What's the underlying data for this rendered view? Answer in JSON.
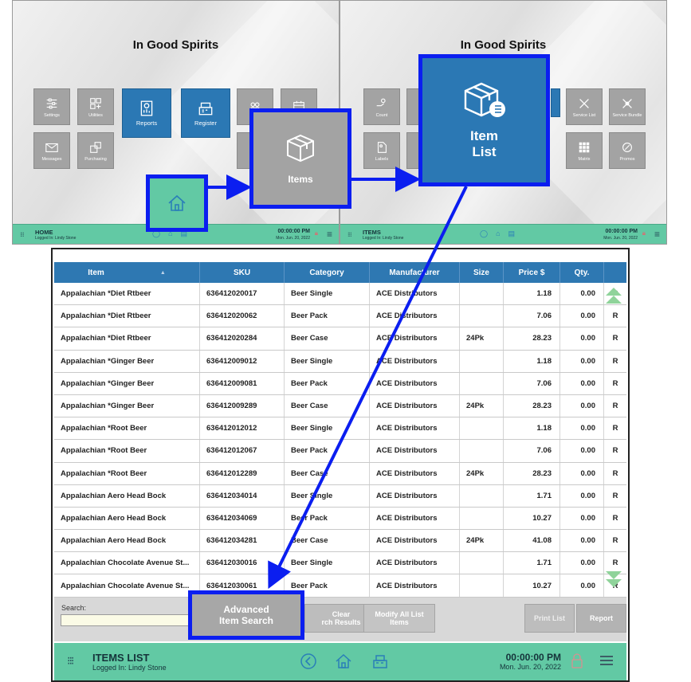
{
  "home_screen": {
    "title": "In Good Spirits",
    "tiles": {
      "settings": "Settings",
      "utilities": "Utilities",
      "reports": "Reports",
      "register": "Register",
      "messages": "Messages",
      "purchasing": "Purchasing"
    },
    "status_bar": {
      "name": "HOME",
      "user": "Logged In:  Lindy Stone",
      "time": "00:00:00 PM",
      "date": "Mon. Jun. 20, 2022"
    }
  },
  "items_screen": {
    "title": "In Good Spirits",
    "tiles": {
      "count": "Count",
      "labels": "Labels",
      "service_list": "Service List",
      "service_bundle": "Service Bundle",
      "matrix": "Matrix",
      "promos": "Promos"
    },
    "status_bar": {
      "name": "ITEMS",
      "user": "Logged In:  Lindy Stone",
      "time": "00:00:00 PM",
      "date": "Mon. Jun. 20, 2022"
    }
  },
  "callouts": {
    "items": "Items",
    "item_list_1": "Item",
    "item_list_2": "List",
    "advanced_search_1": "Advanced",
    "advanced_search_2": "Item Search"
  },
  "items_list": {
    "columns": [
      "Item",
      "SKU",
      "Category",
      "Manufacturer",
      "Size",
      "Price $",
      "Qty."
    ],
    "rows": [
      [
        "Appalachian *Diet Rtbeer",
        "636412020017",
        "Beer Single",
        "ACE Distributors",
        "",
        "1.18",
        "0.00",
        "R"
      ],
      [
        "Appalachian *Diet Rtbeer",
        "636412020062",
        "Beer Pack",
        "ACE Distributors",
        "",
        "7.06",
        "0.00",
        "R"
      ],
      [
        "Appalachian *Diet Rtbeer",
        "636412020284",
        "Beer Case",
        "ACE Distributors",
        "24Pk",
        "28.23",
        "0.00",
        "R"
      ],
      [
        "Appalachian *Ginger Beer",
        "636412009012",
        "Beer Single",
        "ACE Distributors",
        "",
        "1.18",
        "0.00",
        "R"
      ],
      [
        "Appalachian *Ginger Beer",
        "636412009081",
        "Beer Pack",
        "ACE Distributors",
        "",
        "7.06",
        "0.00",
        "R"
      ],
      [
        "Appalachian *Ginger Beer",
        "636412009289",
        "Beer Case",
        "ACE Distributors",
        "24Pk",
        "28.23",
        "0.00",
        "R"
      ],
      [
        "Appalachian *Root Beer",
        "636412012012",
        "Beer Single",
        "ACE Distributors",
        "",
        "1.18",
        "0.00",
        "R"
      ],
      [
        "Appalachian *Root Beer",
        "636412012067",
        "Beer Pack",
        "ACE Distributors",
        "",
        "7.06",
        "0.00",
        "R"
      ],
      [
        "Appalachian *Root Beer",
        "636412012289",
        "Beer Case",
        "ACE Distributors",
        "24Pk",
        "28.23",
        "0.00",
        "R"
      ],
      [
        "Appalachian Aero Head Bock",
        "636412034014",
        "Beer Single",
        "ACE Distributors",
        "",
        "1.71",
        "0.00",
        "R"
      ],
      [
        "Appalachian Aero Head Bock",
        "636412034069",
        "Beer Pack",
        "ACE Distributors",
        "",
        "10.27",
        "0.00",
        "R"
      ],
      [
        "Appalachian Aero Head Bock",
        "636412034281",
        "Beer Case",
        "ACE Distributors",
        "24Pk",
        "41.08",
        "0.00",
        "R"
      ],
      [
        "Appalachian Chocolate Avenue St...",
        "636412030016",
        "Beer Single",
        "ACE Distributors",
        "",
        "1.71",
        "0.00",
        "R"
      ],
      [
        "Appalachian Chocolate Avenue St...",
        "636412030061",
        "Beer Pack",
        "ACE Distributors",
        "",
        "10.27",
        "0.00",
        "R"
      ]
    ],
    "search_label": "Search:",
    "search_value": "",
    "buttons": {
      "clear_1": "Clear",
      "clear_2": "rch Results",
      "modify_1": "Modify All List",
      "modify_2": "Items",
      "print": "Print List",
      "report": "Report"
    },
    "status_bar": {
      "name": "ITEMS LIST",
      "user": "Logged In:   Lindy Stone",
      "time": "00:00:00 PM",
      "date": "Mon. Jun. 20, 2022"
    }
  },
  "colors": {
    "accent_blue": "#2b78b4",
    "status_green": "#62c9a4",
    "highlight_blue": "#0b1ef0",
    "tile_gray": "#a3a3a3"
  }
}
